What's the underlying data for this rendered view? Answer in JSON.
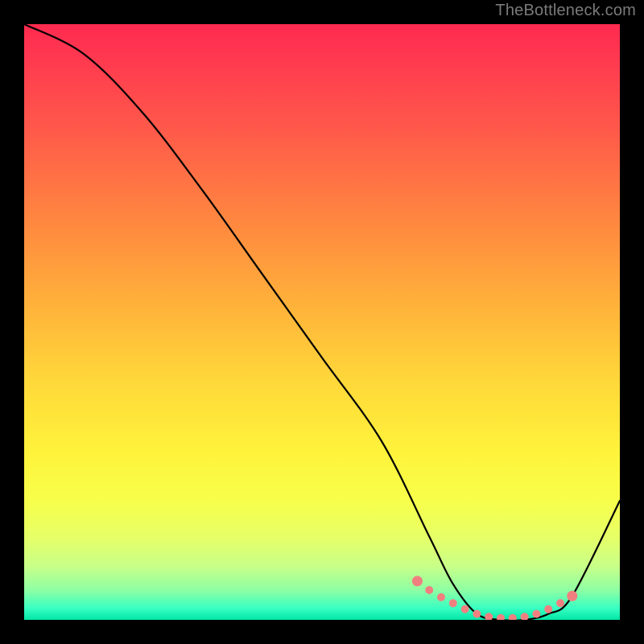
{
  "watermark": "TheBottleneck.com",
  "chart_data": {
    "type": "line",
    "title": "",
    "xlabel": "",
    "ylabel": "",
    "xlim": [
      0,
      100
    ],
    "ylim": [
      0,
      100
    ],
    "series": [
      {
        "name": "bottleneck-curve",
        "x": [
          0,
          10,
          20,
          30,
          40,
          50,
          60,
          68,
          72,
          76,
          80,
          84,
          88,
          92,
          100
        ],
        "y": [
          100,
          95,
          85,
          72,
          58,
          44,
          30,
          14,
          6,
          1,
          0,
          0,
          1,
          4,
          20
        ]
      }
    ],
    "highlight": {
      "name": "sweet-spot",
      "x": [
        66,
        68,
        70,
        72,
        74,
        76,
        78,
        80,
        82,
        84,
        86,
        88,
        90,
        92
      ],
      "y": [
        6.5,
        5,
        3.8,
        2.8,
        1.8,
        1,
        0.5,
        0.3,
        0.3,
        0.5,
        1,
        1.8,
        2.8,
        4
      ]
    },
    "colors": {
      "curve": "#000000",
      "highlight": "#f08080",
      "gradient_top": "#ff2a4f",
      "gradient_bottom": "#00e6a6"
    }
  }
}
